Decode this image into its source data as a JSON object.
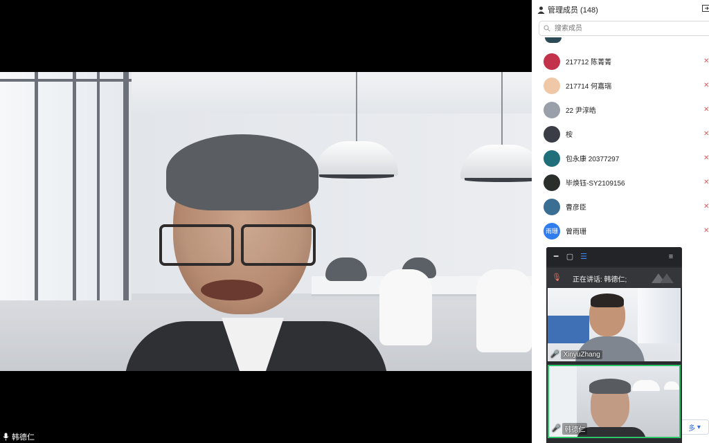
{
  "main_video": {
    "speaker_name": "韩德仁"
  },
  "panel": {
    "title": "管理成员 (148)",
    "search_placeholder": "搜索成员",
    "more_label": "多",
    "members": [
      {
        "name": "217712 陈菁菁",
        "avatar_color": "#c2324a",
        "avatar_text": ""
      },
      {
        "name": "217714 何嘉瑞",
        "avatar_color": "#efc9a7",
        "avatar_text": ""
      },
      {
        "name": "22 尹淳皓",
        "avatar_color": "#9aa0aa",
        "avatar_text": ""
      },
      {
        "name": "桉",
        "avatar_color": "#3a3d45",
        "avatar_text": ""
      },
      {
        "name": "包永康 20377297",
        "avatar_color": "#1f6f7a",
        "avatar_text": ""
      },
      {
        "name": "毕焕钰-SY2109156",
        "avatar_color": "#2a2f2b",
        "avatar_text": ""
      },
      {
        "name": "曹彦臣",
        "avatar_color": "#3b6e93",
        "avatar_text": ""
      },
      {
        "name": "曾雨珊",
        "avatar_color": "#2f7bf0",
        "avatar_text": "雨珊"
      }
    ]
  },
  "mini_window": {
    "talking_label": "正在讲话: 韩德仁;",
    "tiles": [
      {
        "name": "XinyuZhang"
      },
      {
        "name": "韩德仁"
      }
    ]
  },
  "colors": {
    "mute_red": "#e05a5a",
    "active_green": "#2ec46b",
    "link_blue": "#2d6cdf"
  }
}
